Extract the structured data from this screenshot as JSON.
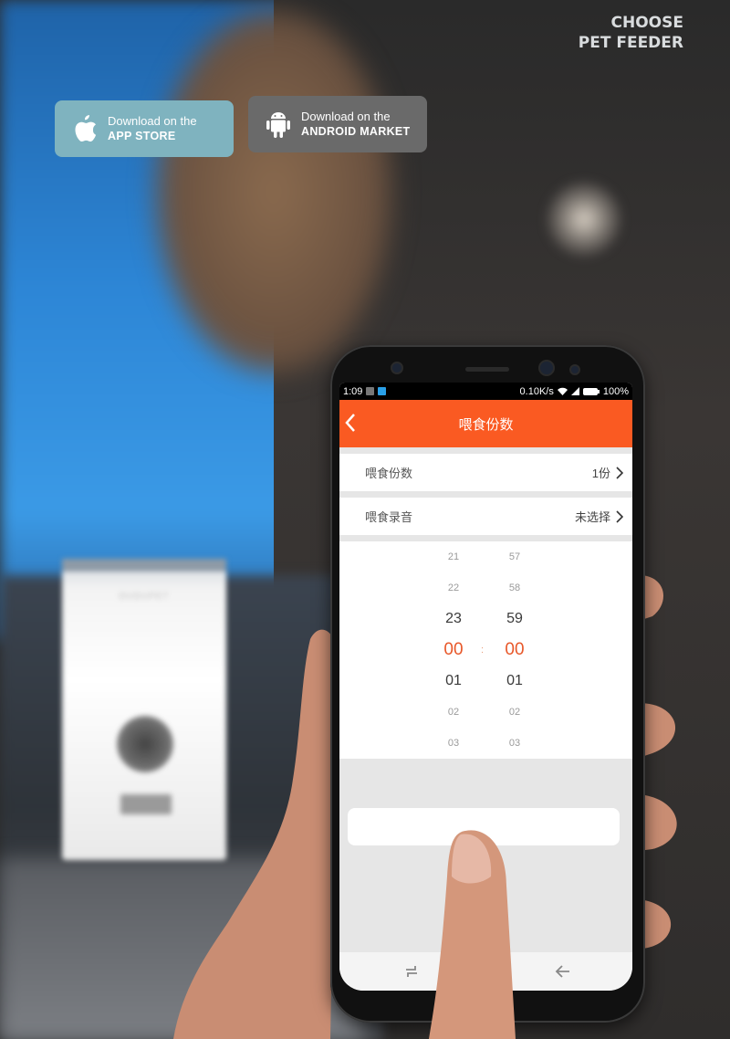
{
  "headline": {
    "line1": "CHOOSE",
    "line2": "PET FEEDER"
  },
  "store_buttons": [
    {
      "icon": "apple-icon",
      "line1": "Download on the",
      "line2": "APP STORE",
      "color": "#7fb3bf"
    },
    {
      "icon": "android-icon",
      "line1": "Download on the",
      "line2": "ANDROID MARKET",
      "color": "#6a6a6a"
    }
  ],
  "background": {
    "feeder_brand": "DUDUPET"
  },
  "phone": {
    "status_bar": {
      "time": "1:09",
      "speed": "0.10K/s",
      "battery": "100%"
    },
    "app_bar": {
      "title": "喂食份数",
      "accent": "#fa5a22"
    },
    "settings": [
      {
        "label": "喂食份数",
        "value": "1份"
      },
      {
        "label": "喂食录音",
        "value": "未选择"
      }
    ],
    "time_picker": {
      "separator": ":",
      "hours": [
        "21",
        "22",
        "23",
        "00",
        "01",
        "02",
        "03"
      ],
      "minutes": [
        "57",
        "58",
        "59",
        "00",
        "01",
        "02",
        "03"
      ],
      "selected_hour": "00",
      "selected_minute": "00",
      "selected_color": "#e8582a"
    },
    "confirm_button": {
      "label": ""
    }
  }
}
